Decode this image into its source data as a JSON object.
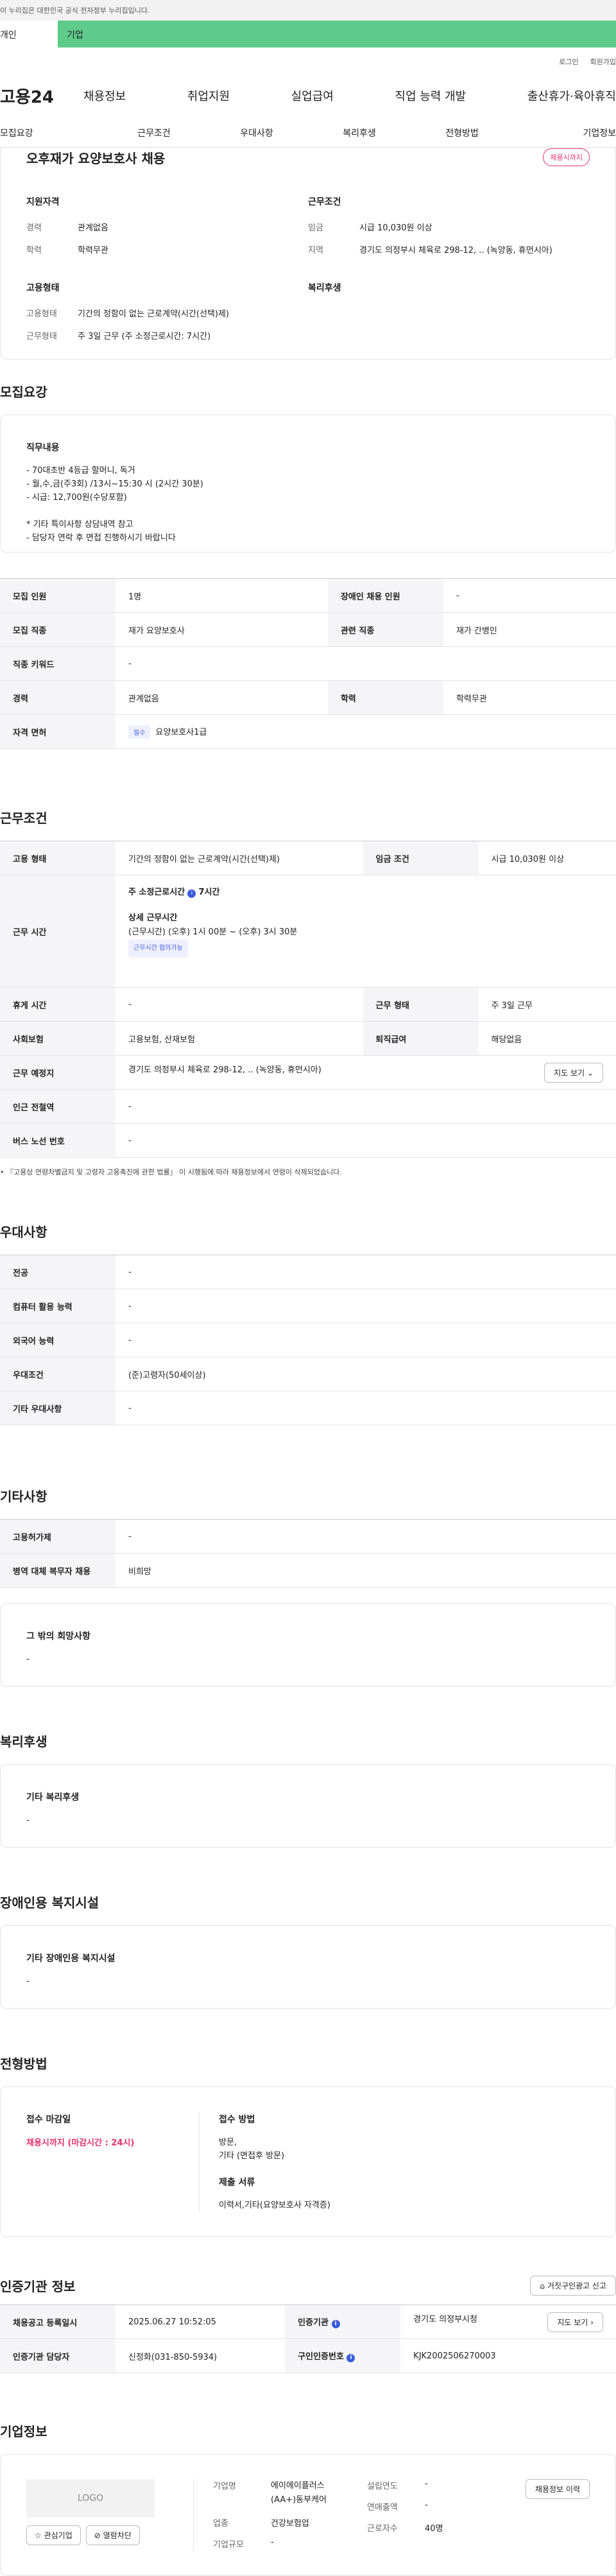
{
  "gov_banner": "이 누리집은 대한민국 공식 전자정부 누리집입니다.",
  "top_tabs": {
    "personal": "개인",
    "corp": "기업"
  },
  "util": {
    "login": "로그인",
    "join": "회원가입"
  },
  "logo": "고용24",
  "gnb": [
    "채용정보",
    "취업지원",
    "실업급여",
    "직업 능력 개발",
    "출산휴가·육아휴직"
  ],
  "subtabs": [
    "모집요강",
    "근무조건",
    "우대사항",
    "복리후생",
    "전형방법",
    "기업정보"
  ],
  "summary": {
    "title": "오후재가 요양보호사 채용",
    "badge": "채용시까지",
    "qual_title": "지원자격",
    "qual": [
      {
        "k": "경력",
        "v": "관계없음"
      },
      {
        "k": "학력",
        "v": "학력무관"
      }
    ],
    "cond_title": "근무조건",
    "cond": [
      {
        "k": "임금",
        "v": "시급 10,030원 이상"
      },
      {
        "k": "지역",
        "v": "경기도 의정부시 체육로 298-12, .. (녹양동, 휴먼시아)"
      }
    ],
    "emp_title": "고용형태",
    "emp": [
      {
        "k": "고용형태",
        "v": "기간의 정함이 없는 근로계약(시간(선택)제)"
      },
      {
        "k": "근무형태",
        "v": "주 3일 근무 (주 소정근로시간: 7시간)"
      }
    ],
    "welfare_title": "복리후생"
  },
  "recruit": {
    "section_title": "모집요강",
    "duty_label": "직무내용",
    "duty_text": "- 70대초반 4등급 할머니, 독거\n- 월,수,금(주3회) /13시~15:30 시 (2시간 30분)\n- 시급: 12,700원(수당포함)\n\n* 기타 특이사항 상담내역 참고\n- 담당자 연락 후 면접 진행하시기 바랍니다",
    "rows": [
      {
        "k1": "모집 인원",
        "v1": "1명",
        "k2": "장애인 채용 인원",
        "v2": "-"
      },
      {
        "k1": "모집 직종",
        "v1": "재가 요양보호사",
        "k2": "관련 직종",
        "v2": "재가 간병인"
      },
      {
        "k1": "직종 키워드",
        "v1": "-"
      },
      {
        "k1": "경력",
        "v1": "관계없음",
        "k2": "학력",
        "v2": "학력무관"
      }
    ],
    "license_label": "자격 면허",
    "license_pill": "필수",
    "license_value": "요양보호사1급"
  },
  "work": {
    "section_title": "근무조건",
    "emp_label": "고용 형태",
    "emp_value": "기간의 정함이 없는 근로계약(시간(선택)제)",
    "wage_label": "임금 조건",
    "wage_value": "시급 10,030원 이상",
    "time_label": "근무 시간",
    "weekly": "주 소정근로시간",
    "weekly_hours": "7시간",
    "detail_title": "상세 근무시간",
    "detail_text": "(근무시간) (오후) 1시 00분 ~ (오후) 3시 30분",
    "detail_pill": "근무시간 협의가능",
    "break_label": "휴게 시간",
    "break_value": "-",
    "shift_label": "근무 형태",
    "shift_value": "주 3일 근무",
    "ins_label": "사회보험",
    "ins_value": "고용보험, 산재보험",
    "sev_label": "퇴직급여",
    "sev_value": "해당없음",
    "loc_label": "근무 예정지",
    "loc_value": "경기도 의정부시 체육로 298-12, .. (녹양동, 휴먼시아)",
    "map_btn": "지도 보기",
    "subway_label": "인근 전철역",
    "subway_value": "-",
    "bus_label": "버스 노선 번호",
    "bus_value": "-",
    "note": "• 『고용상 연령차별금지 및 고령자 고용촉진에 관한 법률』 이 시행됨에 따라 채용정보에서 연령이 삭제되었습니다."
  },
  "pref": {
    "section_title": "우대사항",
    "rows": [
      {
        "k": "전공",
        "v": "-"
      },
      {
        "k": "컴퓨터 활용 능력",
        "v": "-"
      },
      {
        "k": "외국어 능력",
        "v": "-"
      },
      {
        "k": "우대조건",
        "v": "(준)고령자(50세이상)"
      },
      {
        "k": "기타 우대사항",
        "v": "-"
      }
    ]
  },
  "etc": {
    "section_title": "기타사항",
    "rows": [
      {
        "k": "고용허가제",
        "v": "-"
      },
      {
        "k": "병역 대체 복무자 채용",
        "v": "비희망"
      }
    ],
    "hope_label": "그 밖의 희망사항",
    "hope_value": "-"
  },
  "welfare": {
    "section_title": "복리후생",
    "label": "기타 복리후생",
    "value": "-"
  },
  "disability": {
    "section_title": "장애인용 복지시설",
    "label": "기타 장애인용 복지시설",
    "value": "-"
  },
  "apply": {
    "section_title": "전형방법",
    "deadline_label": "접수 마감일",
    "deadline_value": "채용시까지 (마감시간 : 24시)",
    "method_label": "접수 방법",
    "method_value": "방문,\n기타 (면접후 방문)",
    "docs_label": "제출 서류",
    "docs_value": "이력서,기타(요양보호사 자격증)"
  },
  "cert": {
    "section_title": "인증기관 정보",
    "report_btn": "거짓구인광고 신고",
    "reg_label": "채용공고 등록일시",
    "reg_value": "2025.06.27 10:52:05",
    "agency_label": "인증기관",
    "agency_value": "경기도 의정부시청",
    "agency_btn": "지도 보기",
    "manager_label": "인증기관 담당자",
    "manager_value": "신정화(031-850-5934)",
    "job_no_label": "구인인증번호",
    "job_no_value": "KJK2002506270003"
  },
  "company": {
    "section_title": "기업정보",
    "logo_text": "LOGO",
    "fav_btn": "관심기업",
    "block_btn": "열람차단",
    "history_btn": "채용정보 이력",
    "name_label": "기업명",
    "name_value": "에이에이플러스(AA+)동부케어",
    "est_label": "설립연도",
    "est_value": "-",
    "industry_label": "업종",
    "industry_value": "건강보험업",
    "sales_label": "연매출액",
    "sales_value": "-",
    "size_label": "기업규모",
    "size_value": "-",
    "emp_label": "근로자수",
    "emp_value": "40명"
  }
}
